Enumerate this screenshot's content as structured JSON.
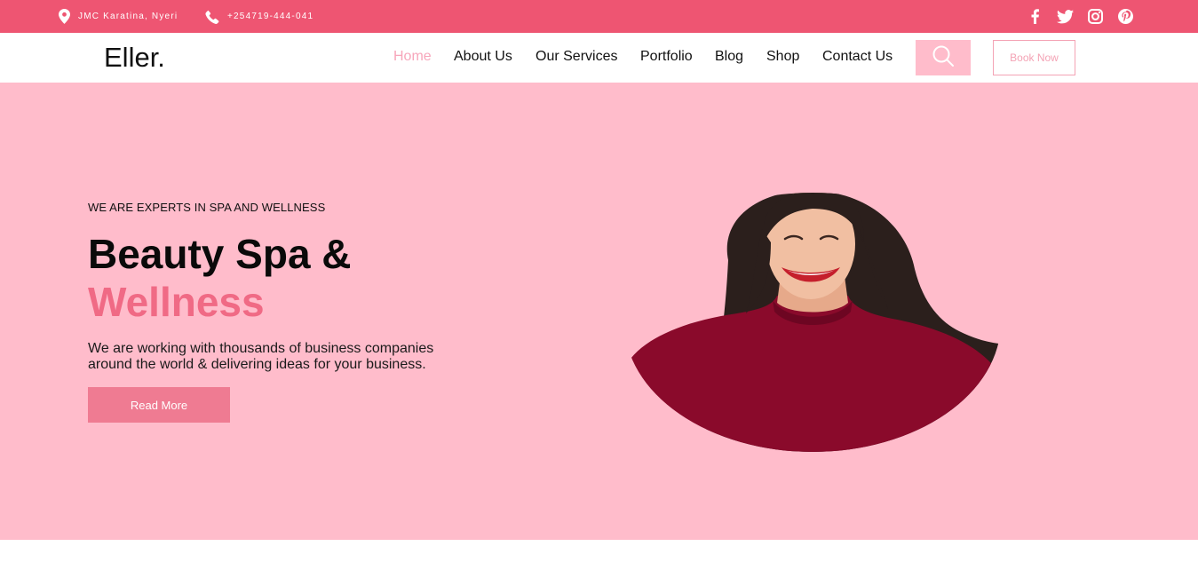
{
  "topbar": {
    "location_icon": "map-pin-icon",
    "location": "JMC Karatina, Nyeri",
    "phone_icon": "phone-icon",
    "phone": "+254719-444-041",
    "social": [
      "facebook-icon",
      "twitter-icon",
      "instagram-icon",
      "pinterest-icon"
    ]
  },
  "nav": {
    "logo": "Eller.",
    "links": [
      "Home",
      "About Us",
      "Our Services",
      "Portfolio",
      "Blog",
      "Shop",
      "Contact Us"
    ],
    "active": "Home",
    "search_icon": "search-icon",
    "book_label": "Book Now"
  },
  "hero": {
    "subtitle": "WE ARE EXPERTS IN SPA AND WELLNESS",
    "title_line1": "Beauty Spa &",
    "title_line2": "Wellness",
    "description": "We are working with thousands of business companies around the world & delivering ideas for your business.",
    "cta_label": "Read More"
  },
  "colors": {
    "topbar": "#ee5572",
    "hero_bg": "#ffbccb",
    "accent": "#f06a85",
    "button": "#ef7b92",
    "active_link": "#f7a6bb"
  }
}
